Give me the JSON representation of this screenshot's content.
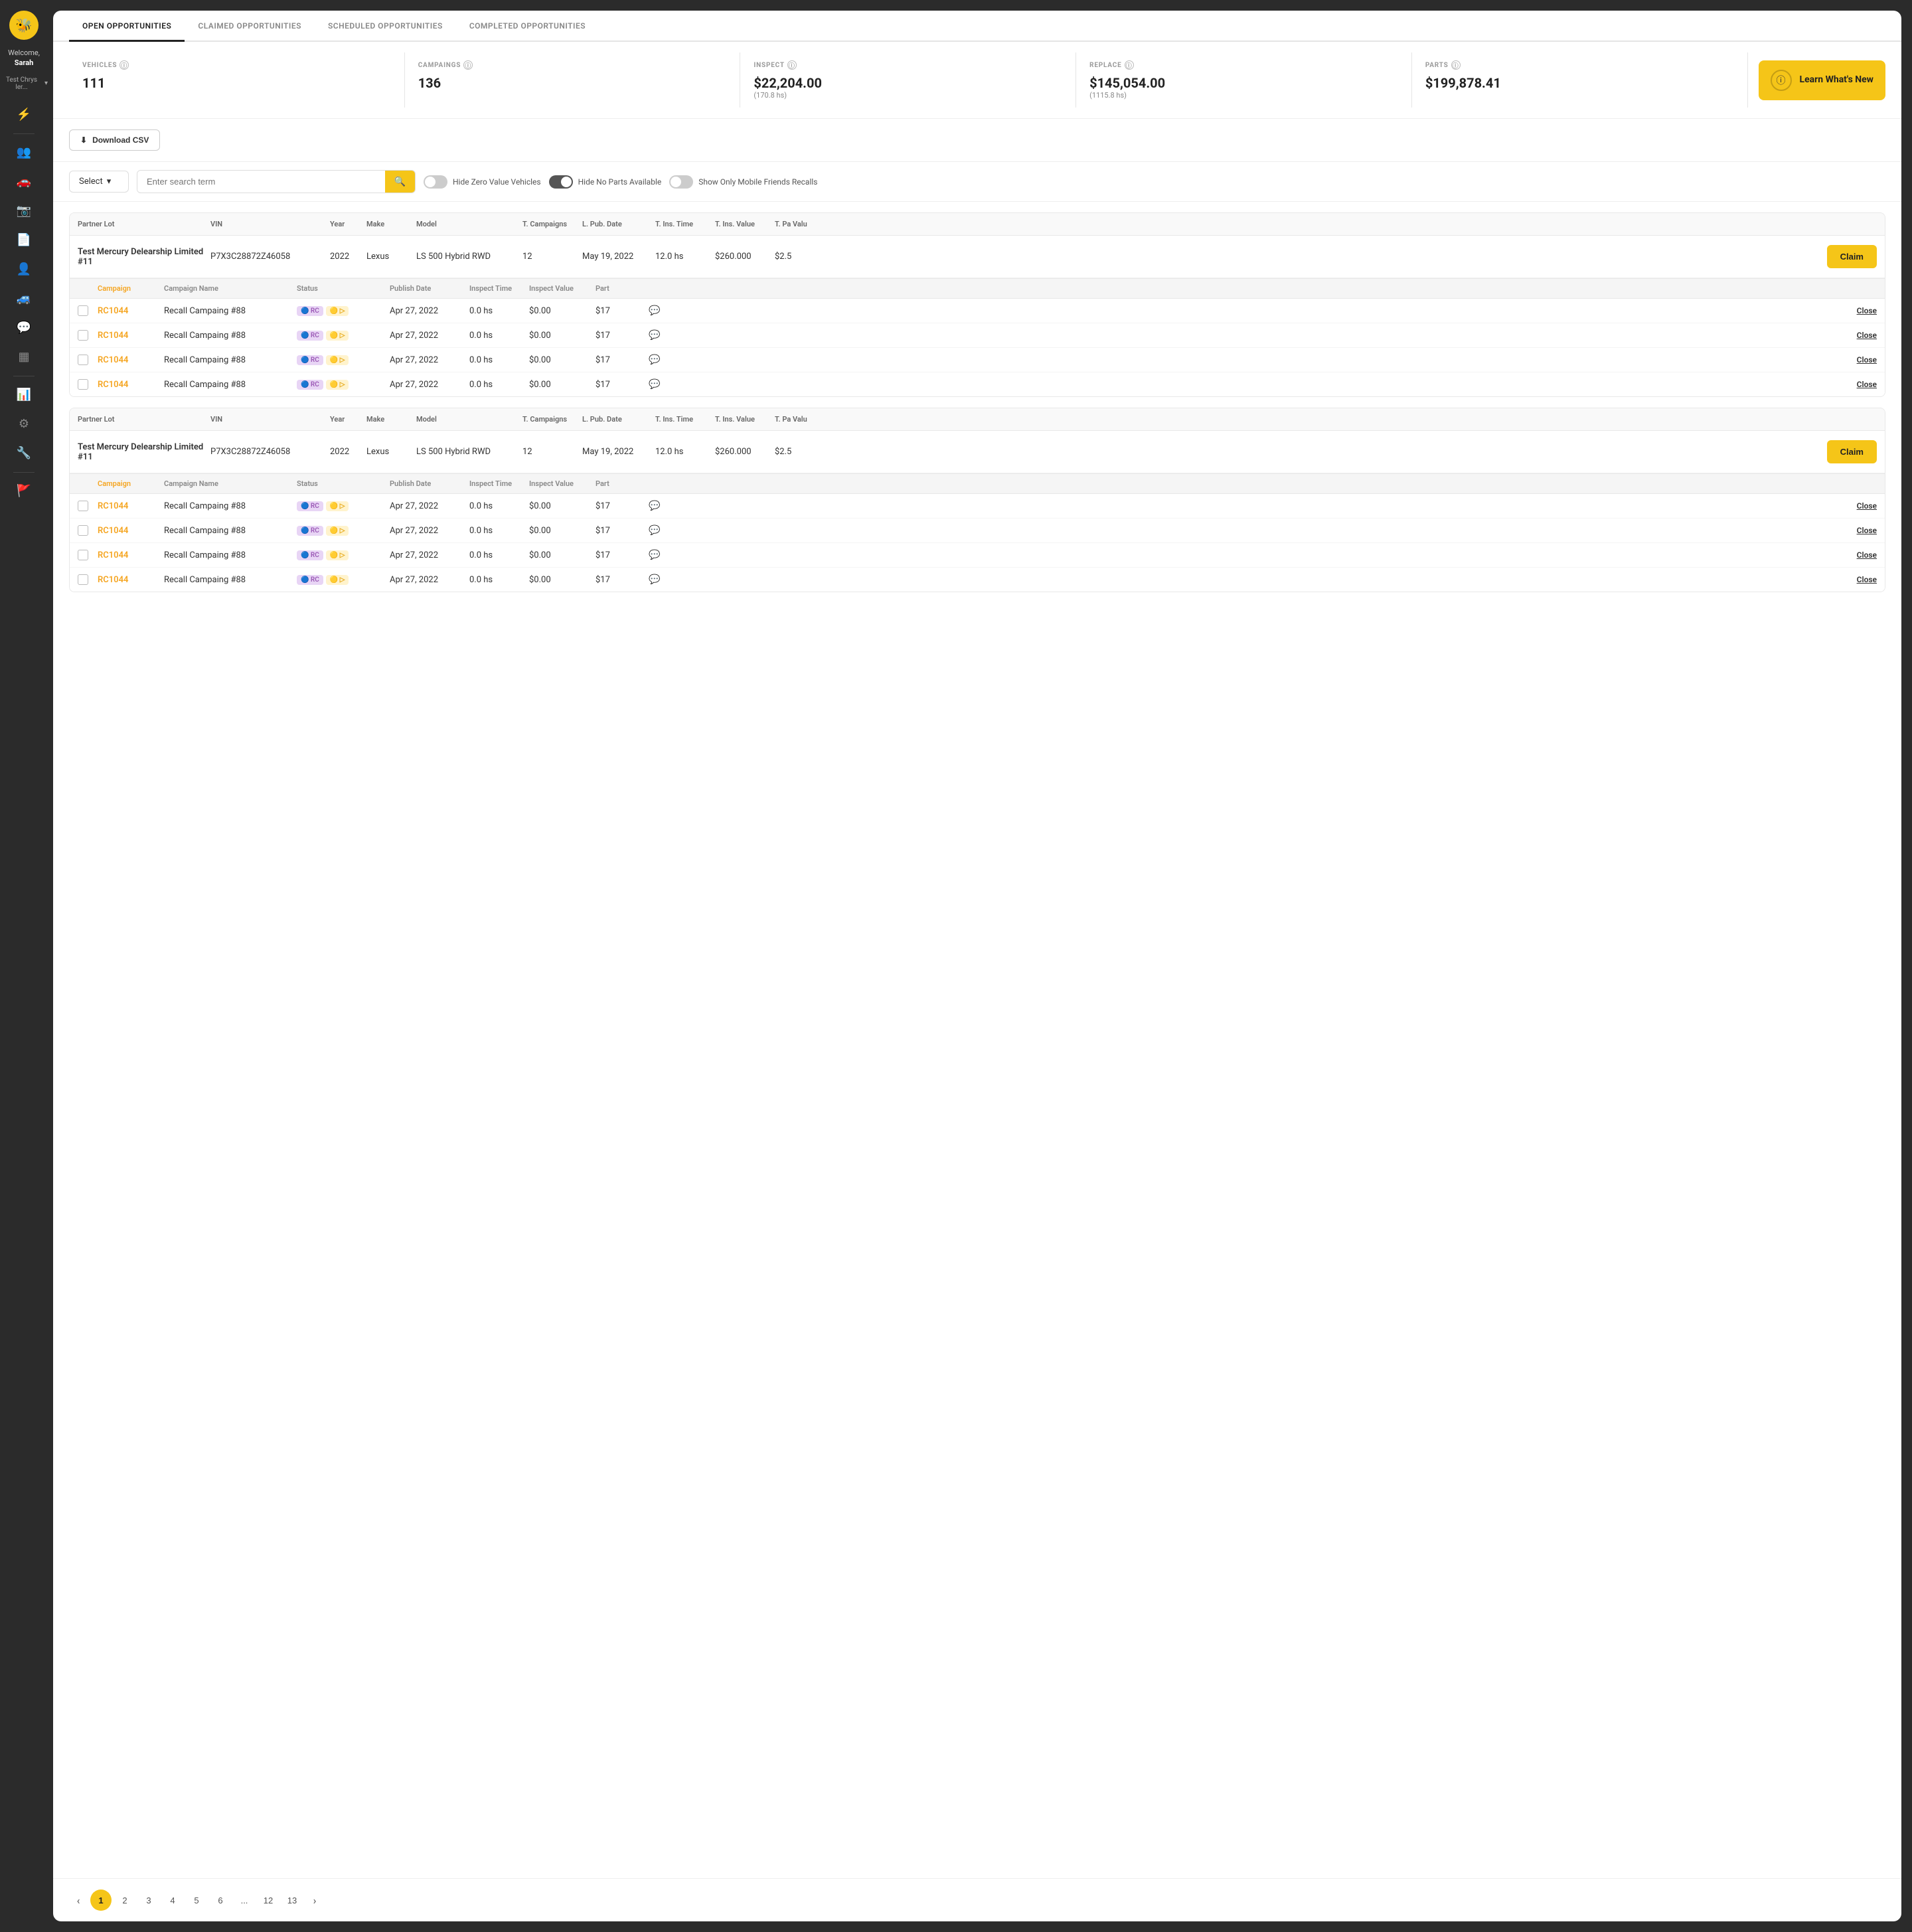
{
  "sidebar": {
    "logo": "🐝",
    "welcome": "Welcome,",
    "username": "Sarah",
    "dealer": "Test Chrys ler...",
    "icons": [
      {
        "name": "lightning-icon",
        "symbol": "⚡",
        "active": true
      },
      {
        "name": "people-icon",
        "symbol": "👥",
        "active": false
      },
      {
        "name": "car-icon",
        "symbol": "🚗",
        "active": false
      },
      {
        "name": "camera-icon",
        "symbol": "📷",
        "active": false
      },
      {
        "name": "document-icon",
        "symbol": "📄",
        "active": false
      },
      {
        "name": "users-icon",
        "symbol": "👤",
        "active": false
      },
      {
        "name": "vehicle-icon",
        "symbol": "🚙",
        "active": false
      },
      {
        "name": "chat-icon",
        "symbol": "💬",
        "active": false
      },
      {
        "name": "grid-icon",
        "symbol": "▦",
        "active": false
      },
      {
        "name": "chart-icon",
        "symbol": "📊",
        "active": false
      },
      {
        "name": "gear-icon",
        "symbol": "⚙",
        "active": false
      },
      {
        "name": "wrench-icon",
        "symbol": "🔧",
        "active": false
      },
      {
        "name": "flag-icon",
        "symbol": "🚩",
        "active": false,
        "red": true
      }
    ]
  },
  "tabs": [
    {
      "id": "open",
      "label": "OPEN OPPORTUNITIES",
      "active": true
    },
    {
      "id": "claimed",
      "label": "CLAIMED OPPORTUNITIES",
      "active": false
    },
    {
      "id": "scheduled",
      "label": "SCHEDULED OPPORTUNITIES",
      "active": false
    },
    {
      "id": "completed",
      "label": "COMPLETED OPPORTUNITIES",
      "active": false
    }
  ],
  "stats": [
    {
      "label": "VEHICLES",
      "value": "111",
      "sub": null
    },
    {
      "label": "CAMPAINGS",
      "value": "136",
      "sub": null
    },
    {
      "label": "INSPECT",
      "value": "$22,204.00",
      "sub": "(170.8 hs)"
    },
    {
      "label": "REPLACE",
      "value": "$145,054.00",
      "sub": "(1115.8 hs)"
    },
    {
      "label": "PARTS",
      "value": "$199,878.41",
      "sub": null
    }
  ],
  "learn_card": {
    "title": "Learn What's New"
  },
  "toolbar": {
    "download_label": "Download CSV"
  },
  "filters": {
    "select_label": "Select",
    "search_placeholder": "Enter search term",
    "toggle1_label": "Hide Zero Value Vehicles",
    "toggle2_label": "Hide No Parts Available",
    "toggle3_label": "Show Only Mobile Friends Recalls",
    "toggle1_on": false,
    "toggle2_on": true,
    "toggle3_on": false
  },
  "table": {
    "headers": [
      "Partner Lot",
      "VIN",
      "Year",
      "Make",
      "Model",
      "T. Campaigns",
      "L. Pub. Date",
      "T. Ins. Time",
      "T. Ins. Value",
      "T. Pa Valu"
    ],
    "campaign_headers": [
      "",
      "Campaign",
      "Campaign Name",
      "Status",
      "",
      "Publish Date",
      "Inspect Time",
      "Inspect Value",
      "Part",
      ""
    ],
    "vehicles": [
      {
        "partner_lot": "Test Mercury Delearship Limited #11",
        "vin": "P7X3C28872Z46058",
        "year": "2022",
        "make": "Lexus",
        "model": "LS 500 Hybrid RWD",
        "t_campaigns": "12",
        "l_pub_date": "May 19, 2022",
        "t_ins_time": "12.0 hs",
        "t_ins_value": "$260.000",
        "t_pa_value": "$2.5",
        "campaigns": [
          {
            "id": "RC1044",
            "name": "Recall Campaing #88",
            "publish_date": "Apr 27, 2022",
            "inspect_time": "0.0 hs",
            "inspect_value": "$0.00",
            "part_value": "$17"
          },
          {
            "id": "RC1044",
            "name": "Recall Campaing #88",
            "publish_date": "Apr 27, 2022",
            "inspect_time": "0.0 hs",
            "inspect_value": "$0.00",
            "part_value": "$17"
          },
          {
            "id": "RC1044",
            "name": "Recall Campaing #88",
            "publish_date": "Apr 27, 2022",
            "inspect_time": "0.0 hs",
            "inspect_value": "$0.00",
            "part_value": "$17"
          },
          {
            "id": "RC1044",
            "name": "Recall Campaing #88",
            "publish_date": "Apr 27, 2022",
            "inspect_time": "0.0 hs",
            "inspect_value": "$0.00",
            "part_value": "$17"
          }
        ]
      },
      {
        "partner_lot": "Test Mercury Delearship Limited #11",
        "vin": "P7X3C28872Z46058",
        "year": "2022",
        "make": "Lexus",
        "model": "LS 500 Hybrid RWD",
        "t_campaigns": "12",
        "l_pub_date": "May 19, 2022",
        "t_ins_time": "12.0 hs",
        "t_ins_value": "$260.000",
        "t_pa_value": "$2.5",
        "campaigns": [
          {
            "id": "RC1044",
            "name": "Recall Campaing #88",
            "publish_date": "Apr 27, 2022",
            "inspect_time": "0.0 hs",
            "inspect_value": "$0.00",
            "part_value": "$17"
          },
          {
            "id": "RC1044",
            "name": "Recall Campaing #88",
            "publish_date": "Apr 27, 2022",
            "inspect_time": "0.0 hs",
            "inspect_value": "$0.00",
            "part_value": "$17"
          },
          {
            "id": "RC1044",
            "name": "Recall Campaing #88",
            "publish_date": "Apr 27, 2022",
            "inspect_time": "0.0 hs",
            "inspect_value": "$0.00",
            "part_value": "$17"
          },
          {
            "id": "RC1044",
            "name": "Recall Campaing #88",
            "publish_date": "Apr 27, 2022",
            "inspect_time": "0.0 hs",
            "inspect_value": "$0.00",
            "part_value": "$17"
          }
        ]
      }
    ]
  },
  "pagination": {
    "current": 1,
    "pages": [
      "1",
      "2",
      "3",
      "4",
      "5",
      "6",
      "...",
      "12",
      "13"
    ]
  }
}
